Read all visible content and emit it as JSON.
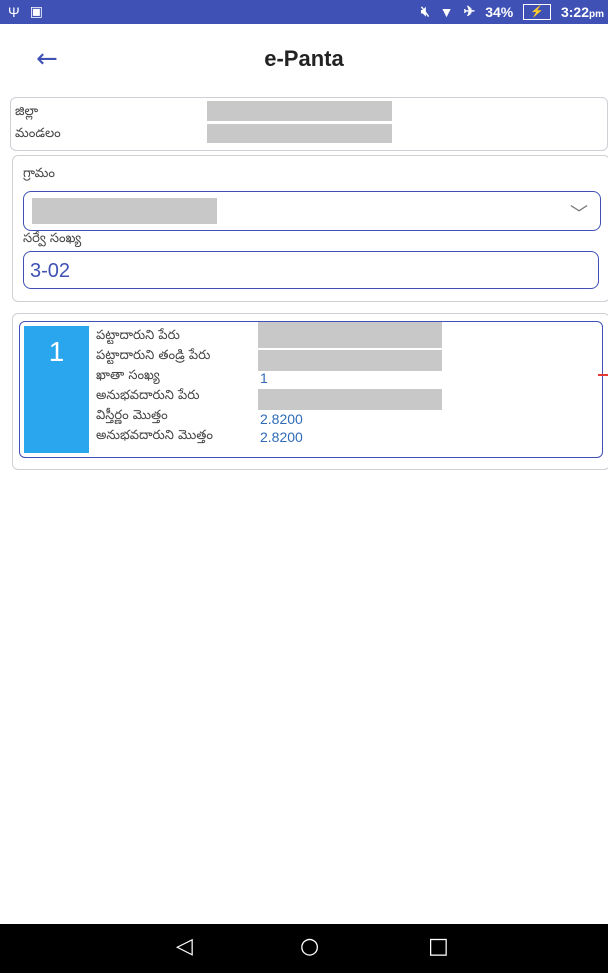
{
  "status": {
    "battery": "34%",
    "time": "3:22",
    "ampm": "pm"
  },
  "appbar": {
    "title": "e-Panta"
  },
  "location": {
    "district_label": "జిల్లా",
    "mandal_label": "మండలం"
  },
  "village": {
    "label": "గ్రామం",
    "survey_label": "సర్వే సంఖ్య",
    "survey_value": "3-02"
  },
  "record": {
    "index": "1",
    "pattadar_name_label": "పట్టాదారుని పేరు",
    "pattadar_father_label": "పట్టాదారుని తండ్రి పేరు",
    "khata_label": "ఖాతా సంఖ్య",
    "khata_value": "1",
    "enjoyer_name_label": "అనుభవదారుని పేరు",
    "total_extent_label": "విస్తీర్ణం మొత్తం",
    "total_extent_value": "2.8200",
    "enjoyer_total_label": "అనుభవదారుని మొత్తం",
    "enjoyer_total_value": "2.8200"
  }
}
